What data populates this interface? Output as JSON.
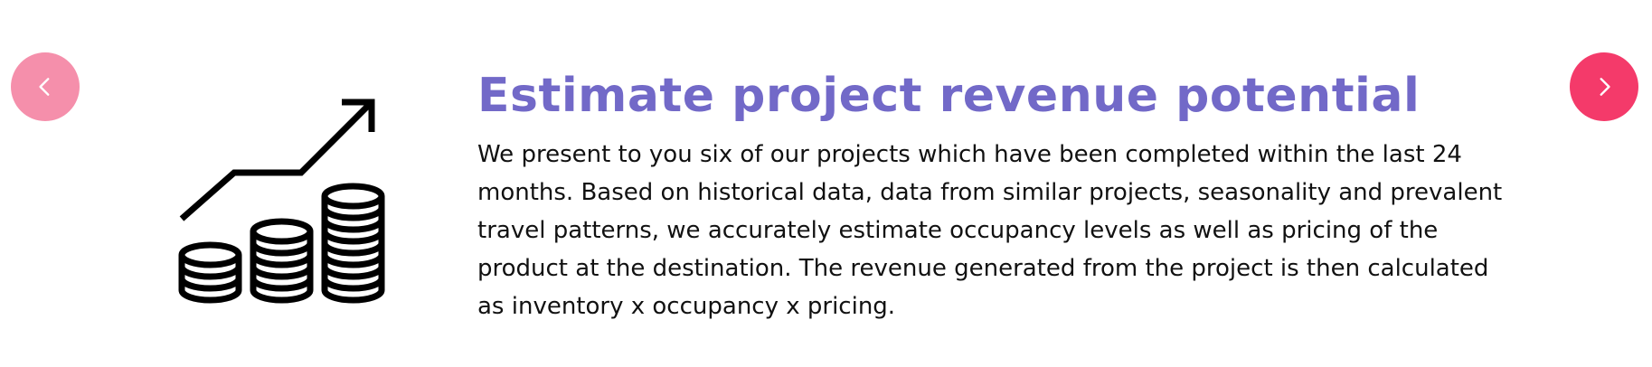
{
  "slide": {
    "title": "Estimate project revenue potential",
    "description": "We present to you six of our projects which have been completed within the last 24 months.  Based on historical data, data from similar projects, seasonality and prevalent travel patterns, we accurately estimate occupancy levels as well as pricing of the product at the destination.  The revenue generated from the project is then calculated as inventory x occupancy x pricing.",
    "icon": "coin-stacks-growth-icon"
  },
  "navigation": {
    "prev_icon": "chevron-left-icon",
    "next_icon": "chevron-right-icon"
  },
  "colors": {
    "title": "#7269c8",
    "prev_button": "#f58fab",
    "next_button": "#f43a6a",
    "text": "#111111"
  }
}
